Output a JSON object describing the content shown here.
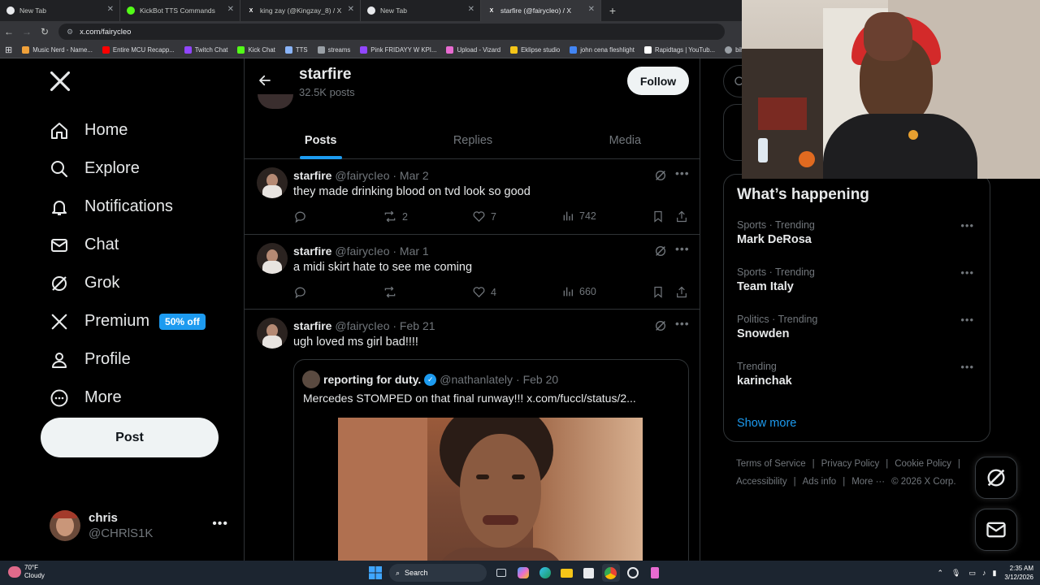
{
  "browser": {
    "tabs": [
      {
        "title": "New Tab",
        "icon": "chrome-icon",
        "active": false
      },
      {
        "title": "KickBot TTS Commands",
        "icon": "kickbot-icon",
        "active": false
      },
      {
        "title": "king zay (@Kingzay_8) / X",
        "icon": "x-icon",
        "active": false
      },
      {
        "title": "New Tab",
        "icon": "chrome-icon",
        "active": false
      },
      {
        "title": "starfire (@fairycleo) / X",
        "icon": "x-icon",
        "active": true
      }
    ],
    "new_tab_symbol": "+",
    "url": "x.com/fairycleo",
    "bookmarks": [
      {
        "label": "Music Nerd - Name...",
        "color": "#f0a13a"
      },
      {
        "label": "Entire MCU Recapp...",
        "color": "#ff0000"
      },
      {
        "label": "Twitch Chat",
        "color": "#9146ff"
      },
      {
        "label": "Kick Chat",
        "color": "#53fc18"
      },
      {
        "label": "TTS",
        "color": "#8ab4f8"
      },
      {
        "label": "streams",
        "color": "#9aa0a6"
      },
      {
        "label": "Pink FRIDAYY W KPI...",
        "color": "#9146ff"
      },
      {
        "label": "Upload - Vizard",
        "color": "#e86bd1"
      },
      {
        "label": "Eklipse studio",
        "color": "#f5c518"
      },
      {
        "label": "john cena fleshlight",
        "color": "#4285f4"
      },
      {
        "label": "Rapidtags | YouTub...",
        "color": "#ffffff"
      },
      {
        "label": "bih links",
        "color": "#9aa0a6"
      }
    ]
  },
  "sidebar": {
    "items": [
      {
        "label": "Home",
        "icon": "home-icon"
      },
      {
        "label": "Explore",
        "icon": "search-icon"
      },
      {
        "label": "Notifications",
        "icon": "bell-icon"
      },
      {
        "label": "Chat",
        "icon": "mail-icon"
      },
      {
        "label": "Grok",
        "icon": "grok-icon"
      },
      {
        "label": "Premium",
        "icon": "x-icon",
        "badge": "50% off"
      },
      {
        "label": "Profile",
        "icon": "person-icon"
      },
      {
        "label": "More",
        "icon": "more-circle-icon"
      }
    ],
    "post_label": "Post",
    "account": {
      "name": "chris",
      "handle": "@CHRlS1K"
    }
  },
  "profile": {
    "name": "starfire",
    "posts_count": "32.5K posts",
    "follow_label": "Follow",
    "tabs": [
      "Posts",
      "Replies",
      "Media"
    ],
    "selected_tab": "Posts"
  },
  "tweets": [
    {
      "name": "starfire",
      "handle": "@fairycIeo",
      "date": "· Mar 2",
      "text": "they made drinking blood on tvd look so good",
      "replies": "",
      "reposts": "2",
      "likes": "7",
      "views": "742"
    },
    {
      "name": "starfire",
      "handle": "@fairycIeo",
      "date": "· Mar 1",
      "text": "a midi skirt hate to see me coming",
      "replies": "",
      "reposts": "",
      "likes": "4",
      "views": "660"
    },
    {
      "name": "starfire",
      "handle": "@fairycIeo",
      "date": "· Feb 21",
      "text": "ugh loved ms girl bad!!!!",
      "quote": {
        "name": "reporting for duty.",
        "handle": "@nathanlately",
        "date": "· Feb 20",
        "text": "Mercedes STOMPED on that final runway!!!  x.com/fuccl/status/2..."
      }
    }
  ],
  "trends": {
    "title": "What’s happening",
    "items": [
      {
        "category": "Sports · Trending",
        "name": "Mark DeRosa"
      },
      {
        "category": "Sports · Trending",
        "name": "Team Italy"
      },
      {
        "category": "Politics · Trending",
        "name": "Snowden"
      },
      {
        "category": "Trending",
        "name": "karinchak"
      }
    ],
    "show_more": "Show more"
  },
  "footer": {
    "links": [
      "Terms of Service",
      "|",
      "Privacy Policy",
      "|",
      "Cookie Policy",
      "|",
      "Accessibility",
      "|",
      "Ads info",
      "|",
      "More ···",
      "© 2026 X Corp."
    ]
  },
  "taskbar": {
    "temperature": "70°F",
    "condition": "Cloudy",
    "search_label": "Search",
    "time": "2:35 AM",
    "date": "3/12/2026"
  },
  "colors": {
    "accent": "#1d9bf0",
    "background": "#000000",
    "border": "#2f3336",
    "muted_text": "#71767b"
  }
}
